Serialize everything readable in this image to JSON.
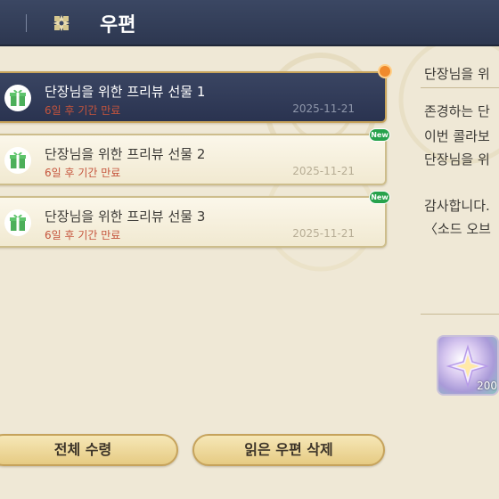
{
  "header": {
    "title": "우편",
    "icon": "mail-flower-icon"
  },
  "mails": [
    {
      "subject": "단장님을 위한 프리뷰 선물 1",
      "expire": "6일 후 기간 만료",
      "date": "2025-11-21",
      "selected": true,
      "badge": "dot"
    },
    {
      "subject": "단장님을 위한 프리뷰 선물 2",
      "expire": "6일 후 기간 만료",
      "date": "2025-11-21",
      "selected": false,
      "badge": "New"
    },
    {
      "subject": "단장님을 위한 프리뷰 선물 3",
      "expire": "6일 후 기간 만료",
      "date": "2025-11-21",
      "selected": false,
      "badge": "New"
    }
  ],
  "detail": {
    "title": "단장님을 위",
    "lines": [
      "존경하는 단",
      "이번 콜라보",
      "단장님을 위",
      "감사합니다.",
      "〈소드 오브 "
    ],
    "reward_qty": "200"
  },
  "buttons": {
    "receive_all": "전체 수령",
    "delete_read": "읽은 우편 삭제"
  },
  "colors": {
    "header": "#2f3a55",
    "accent_gold": "#c8a45b",
    "new_badge": "#27a24c",
    "expire_text": "#c5543c"
  }
}
